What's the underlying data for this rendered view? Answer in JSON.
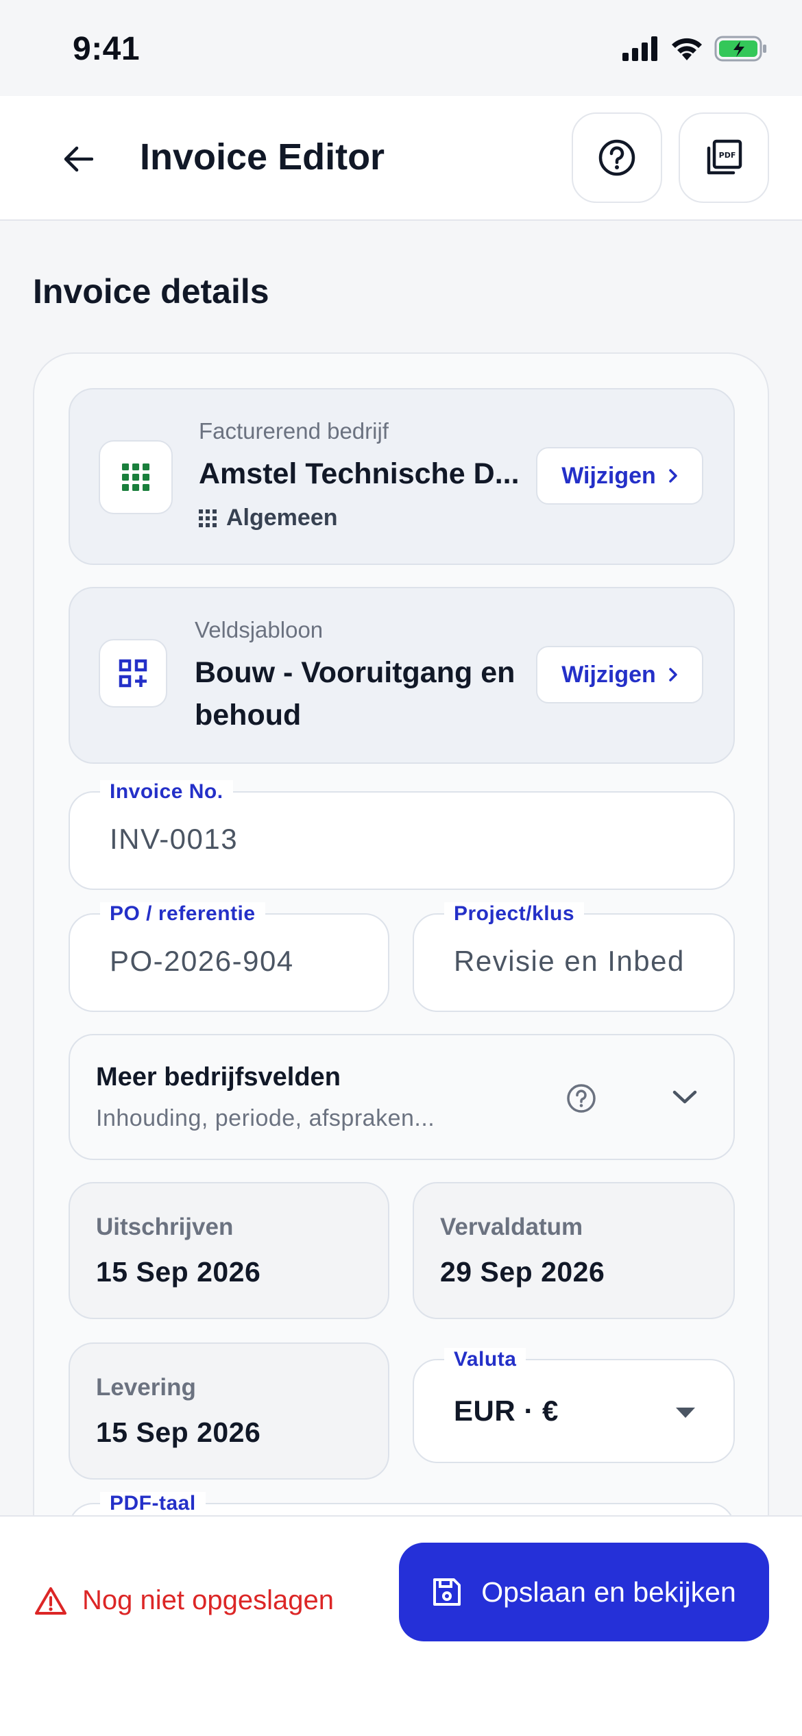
{
  "status_bar": {
    "time": "9:41"
  },
  "header": {
    "title": "Invoice Editor"
  },
  "section": {
    "title": "Invoice details"
  },
  "company": {
    "label": "Facturerend bedrijf",
    "value": "Amstel Technische D...",
    "sub": "Algemeen",
    "change_label": "Wijzigen"
  },
  "template": {
    "label": "Veldsjabloon",
    "value_line1": "Bouw - Vooruitgang en",
    "value_line2": "behoud",
    "change_label": "Wijzigen"
  },
  "invoice_no": {
    "label": "Invoice No.",
    "value": "INV-0013"
  },
  "po_ref": {
    "label": "PO / referentie",
    "value": "PO-2026-904"
  },
  "project": {
    "label": "Project/klus",
    "value": "Revisie en Inbed"
  },
  "more_fields": {
    "title": "Meer bedrijfsvelden",
    "subtitle": "Inhouding, periode, afspraken..."
  },
  "issue_date": {
    "label": "Uitschrijven",
    "value": "15 Sep 2026"
  },
  "due_date": {
    "label": "Vervaldatum",
    "value": "29 Sep 2026"
  },
  "delivery_date": {
    "label": "Levering",
    "value": "15 Sep 2026"
  },
  "currency": {
    "label": "Valuta",
    "value": "EUR · €"
  },
  "pdf_language": {
    "label": "PDF-taal"
  },
  "footer": {
    "unsaved": "Nog niet opgeslagen",
    "save_button": "Opslaan en bekijken"
  },
  "colors": {
    "accent": "#2530d8",
    "link": "#2430c8",
    "warning": "#dc2626",
    "company_icon": "#1a7f3c"
  }
}
